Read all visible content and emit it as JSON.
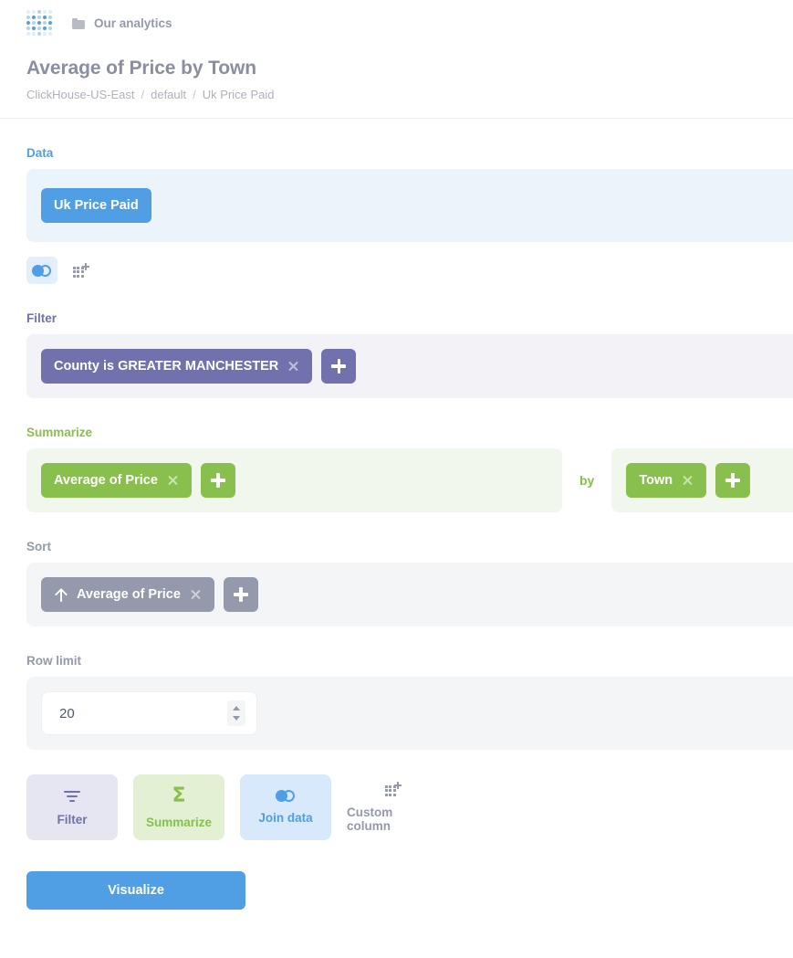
{
  "app": {
    "logo_icon": "metabase-dot-grid-logo",
    "collection": {
      "icon": "folder-icon",
      "label": "Our analytics"
    }
  },
  "header": {
    "title": "Average of Price by Town",
    "breadcrumb": {
      "database": "ClickHouse-US-East",
      "schema": "default",
      "table": "Uk Price Paid",
      "separator": "/"
    }
  },
  "notebook": {
    "data_step": {
      "label": "Data",
      "table_chip": "Uk Price Paid",
      "icons": [
        {
          "name": "join-data-icon",
          "active": true
        },
        {
          "name": "custom-column-icon",
          "active": false
        }
      ]
    },
    "filter_step": {
      "label": "Filter",
      "chips": [
        {
          "text": "County is GREATER MANCHESTER"
        }
      ],
      "add_label": "+"
    },
    "summarize_step": {
      "label": "Summarize",
      "metric_chips": [
        {
          "text": "Average of Price"
        }
      ],
      "by_label": "by",
      "breakout_chips": [
        {
          "text": "Town"
        }
      ]
    },
    "sort_step": {
      "label": "Sort",
      "chips": [
        {
          "text": "Average of Price",
          "direction": "ascending"
        }
      ]
    },
    "limit_step": {
      "label": "Row limit",
      "value": "20"
    }
  },
  "actions": [
    {
      "label": "Filter",
      "icon": "funnel-icon",
      "color": "#7172AD"
    },
    {
      "label": "Summarize",
      "icon": "sigma-icon",
      "color": "#88BF4D"
    },
    {
      "label": "Join data",
      "icon": "join-data-icon",
      "color": "#509EE3"
    },
    {
      "label": "Custom column",
      "icon": "custom-column-icon",
      "color": "#949AAB"
    }
  ],
  "visualize": {
    "label": "Visualize"
  },
  "colors": {
    "blue": "#509EE3",
    "purple": "#7172AD",
    "green": "#88BF4D",
    "gray": "#949AAB",
    "text": "#4C5773"
  }
}
